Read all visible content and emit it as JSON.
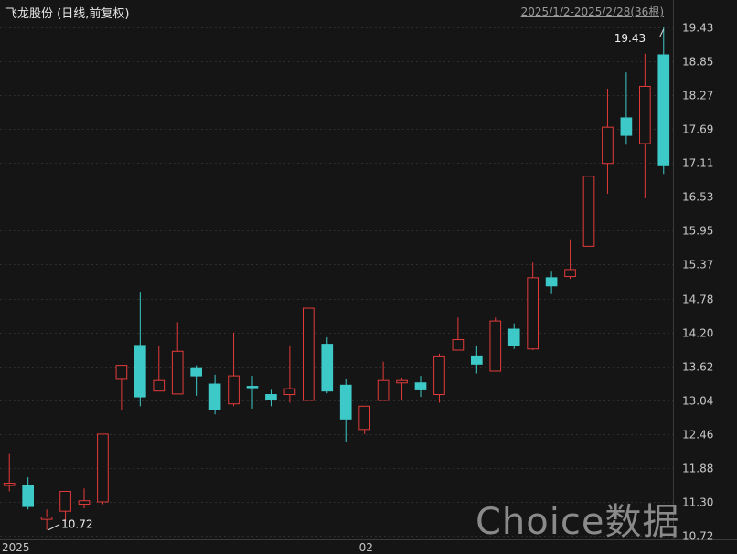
{
  "header": {
    "title": "飞龙股份 (日线,前复权)",
    "range": "2025/1/2-2025/2/28(36根)"
  },
  "watermark": "Choice数据",
  "colors": {
    "up": "#e23b3b",
    "down": "#3ec9c9",
    "bg": "#151515",
    "grid": "#2d2d2d"
  },
  "chart_data": {
    "type": "candlestick",
    "yticks": [
      "19.43",
      "18.85",
      "18.27",
      "17.69",
      "17.11",
      "16.53",
      "15.95",
      "15.37",
      "14.78",
      "14.20",
      "13.62",
      "13.04",
      "12.46",
      "11.88",
      "11.30",
      "10.72"
    ],
    "ylim": [
      10.72,
      19.43
    ],
    "xlabels": [
      {
        "label": "2025",
        "index": 0
      },
      {
        "label": "02",
        "index": 19
      }
    ],
    "annotations": [
      {
        "text": "19.43",
        "index": 35,
        "kind": "high"
      },
      {
        "text": "10.72",
        "index": 2,
        "kind": "low"
      }
    ],
    "candles": [
      {
        "o": 11.58,
        "c": 11.62,
        "h": 12.12,
        "l": 11.48
      },
      {
        "o": 11.58,
        "c": 11.22,
        "h": 11.72,
        "l": 11.17
      },
      {
        "o": 11.0,
        "c": 11.04,
        "h": 11.17,
        "l": 10.82
      },
      {
        "o": 11.14,
        "c": 11.48,
        "h": 11.48,
        "l": 10.97
      },
      {
        "o": 11.26,
        "c": 11.32,
        "h": 11.53,
        "l": 11.19
      },
      {
        "o": 11.3,
        "c": 12.46,
        "h": 12.46,
        "l": 11.26
      },
      {
        "o": 13.4,
        "c": 13.64,
        "h": 13.64,
        "l": 12.88
      },
      {
        "o": 13.98,
        "c": 13.1,
        "h": 14.9,
        "l": 12.94
      },
      {
        "o": 13.2,
        "c": 13.38,
        "h": 13.98,
        "l": 13.2
      },
      {
        "o": 13.15,
        "c": 13.88,
        "h": 14.38,
        "l": 13.15
      },
      {
        "o": 13.6,
        "c": 13.46,
        "h": 13.64,
        "l": 13.12
      },
      {
        "o": 13.32,
        "c": 12.88,
        "h": 13.48,
        "l": 12.8
      },
      {
        "o": 12.98,
        "c": 13.46,
        "h": 14.2,
        "l": 12.94
      },
      {
        "o": 13.28,
        "c": 13.26,
        "h": 13.46,
        "l": 12.9
      },
      {
        "o": 13.14,
        "c": 13.06,
        "h": 13.22,
        "l": 12.94
      },
      {
        "o": 13.14,
        "c": 13.24,
        "h": 13.98,
        "l": 13.0
      },
      {
        "o": 13.04,
        "c": 14.62,
        "h": 14.62,
        "l": 13.04
      },
      {
        "o": 14.0,
        "c": 13.2,
        "h": 14.12,
        "l": 13.16
      },
      {
        "o": 13.3,
        "c": 12.72,
        "h": 13.4,
        "l": 12.32
      },
      {
        "o": 12.54,
        "c": 12.94,
        "h": 12.94,
        "l": 12.46
      },
      {
        "o": 13.04,
        "c": 13.38,
        "h": 13.7,
        "l": 13.04
      },
      {
        "o": 13.34,
        "c": 13.38,
        "h": 13.42,
        "l": 13.04
      },
      {
        "o": 13.34,
        "c": 13.22,
        "h": 13.46,
        "l": 13.1
      },
      {
        "o": 13.14,
        "c": 13.8,
        "h": 13.84,
        "l": 13.0
      },
      {
        "o": 13.9,
        "c": 14.08,
        "h": 14.46,
        "l": 13.9
      },
      {
        "o": 13.8,
        "c": 13.66,
        "h": 13.98,
        "l": 13.5
      },
      {
        "o": 13.54,
        "c": 14.4,
        "h": 14.46,
        "l": 13.54
      },
      {
        "o": 14.26,
        "c": 13.98,
        "h": 14.36,
        "l": 13.92
      },
      {
        "o": 13.92,
        "c": 15.14,
        "h": 15.4,
        "l": 13.9
      },
      {
        "o": 15.14,
        "c": 15.0,
        "h": 15.26,
        "l": 14.86
      },
      {
        "o": 15.16,
        "c": 15.28,
        "h": 15.8,
        "l": 15.12
      },
      {
        "o": 15.68,
        "c": 16.88,
        "h": 16.88,
        "l": 15.68
      },
      {
        "o": 17.1,
        "c": 17.72,
        "h": 18.38,
        "l": 16.58
      },
      {
        "o": 17.88,
        "c": 17.58,
        "h": 18.66,
        "l": 17.42
      },
      {
        "o": 17.44,
        "c": 18.42,
        "h": 18.98,
        "l": 16.5
      },
      {
        "o": 18.96,
        "c": 17.06,
        "h": 19.43,
        "l": 16.92
      }
    ]
  }
}
